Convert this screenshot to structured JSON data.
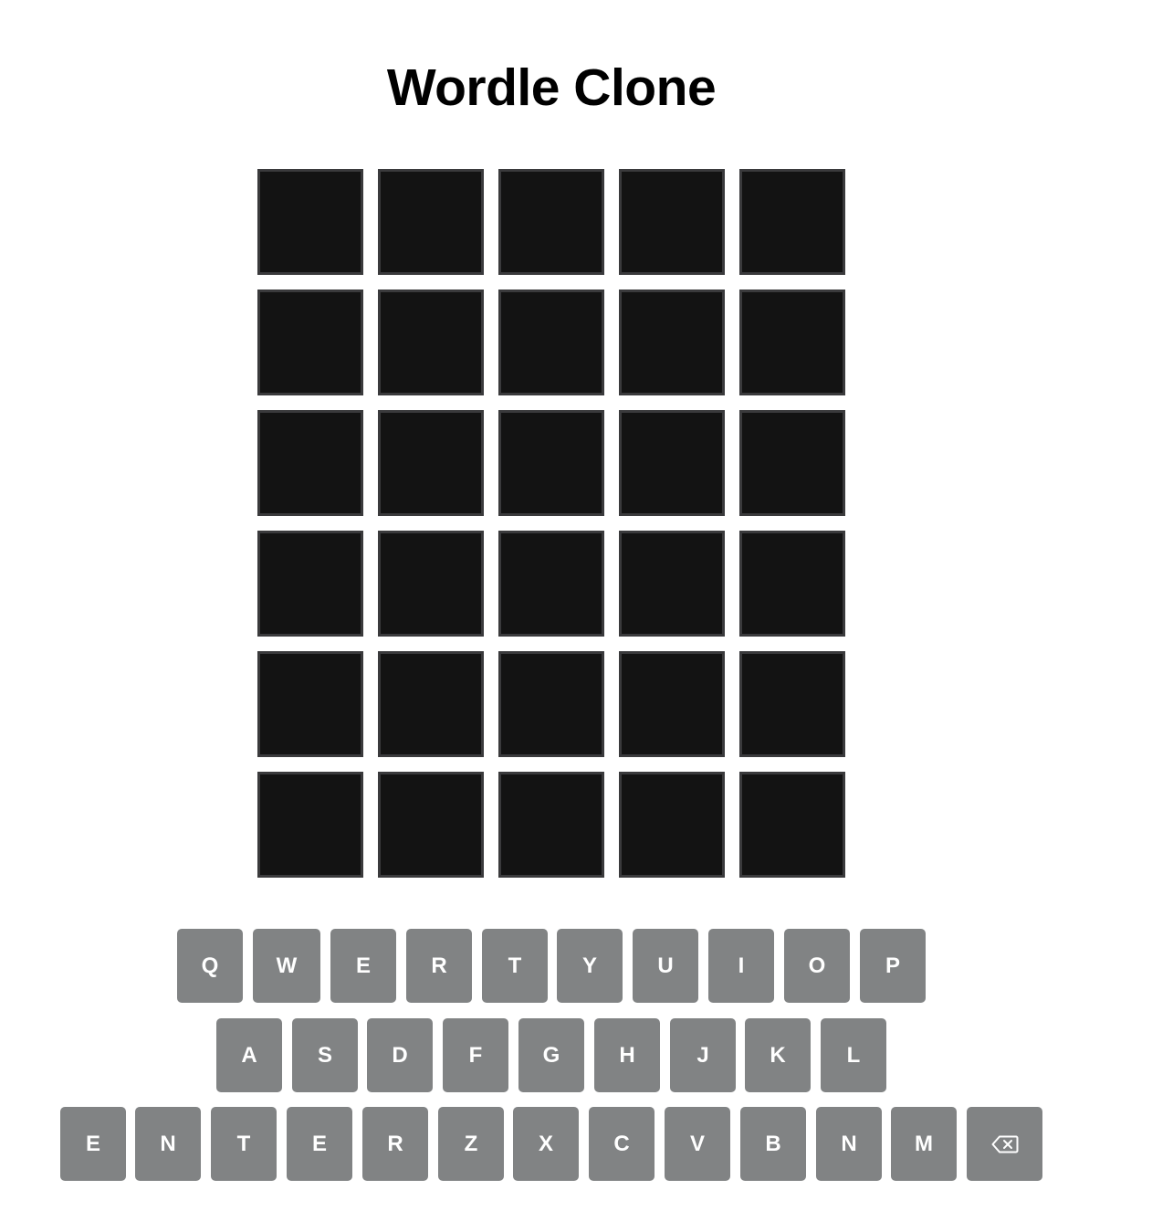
{
  "header": {
    "title": "Wordle Clone"
  },
  "board": {
    "rows": [
      [
        "",
        "",
        "",
        "",
        ""
      ],
      [
        "",
        "",
        "",
        "",
        ""
      ],
      [
        "",
        "",
        "",
        "",
        ""
      ],
      [
        "",
        "",
        "",
        "",
        ""
      ],
      [
        "",
        "",
        "",
        "",
        ""
      ],
      [
        "",
        "",
        "",
        "",
        ""
      ]
    ]
  },
  "keyboard": {
    "rows": [
      [
        "Q",
        "W",
        "E",
        "R",
        "T",
        "Y",
        "U",
        "I",
        "O",
        "P"
      ],
      [
        "A",
        "S",
        "D",
        "F",
        "G",
        "H",
        "J",
        "K",
        "L"
      ],
      [
        "E",
        "N",
        "T",
        "E",
        "R",
        "Z",
        "X",
        "C",
        "V",
        "B",
        "N",
        "M"
      ]
    ],
    "backspace_icon": "backspace-icon"
  },
  "colors": {
    "tile_background": "#131313",
    "tile_border": "#3a3a3c",
    "key_background": "#818384",
    "key_text": "#ffffff",
    "title_text": "#000000"
  }
}
